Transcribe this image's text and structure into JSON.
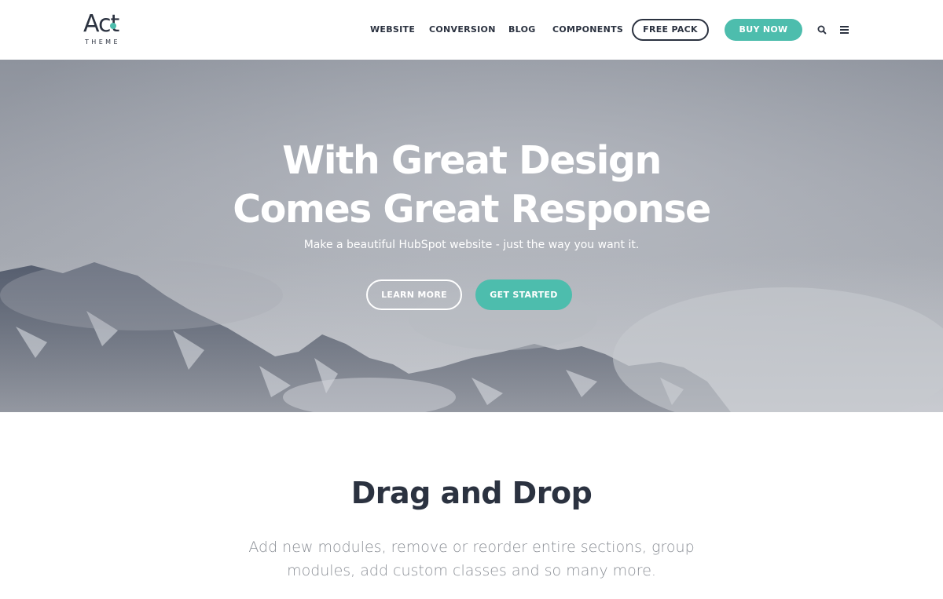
{
  "header": {
    "logo": {
      "word": "Act",
      "sub": "THEME"
    },
    "nav": {
      "website": "WEBSITE",
      "conversion": "CONVERSION",
      "blog": "BLOG",
      "components": "COMPONENTS",
      "free_pack": "FREE PACK",
      "buy_now": "BUY NOW"
    },
    "icons": [
      "search-icon",
      "menu-icon"
    ]
  },
  "hero": {
    "title_line1": "With Great Design",
    "title_line2": "Comes Great Response",
    "subtitle": "Make a beautiful HubSpot website - just the way you want it.",
    "learn_more": "LEARN MORE",
    "get_started": "GET STARTED"
  },
  "features": {
    "title": "Drag and Drop",
    "description": "Add new modules, remove or reorder entire sections, group modules, add custom classes and so many more."
  },
  "colors": {
    "accent": "#4dbdad",
    "dark": "#2b3240",
    "muted_text": "#8b8f96"
  }
}
